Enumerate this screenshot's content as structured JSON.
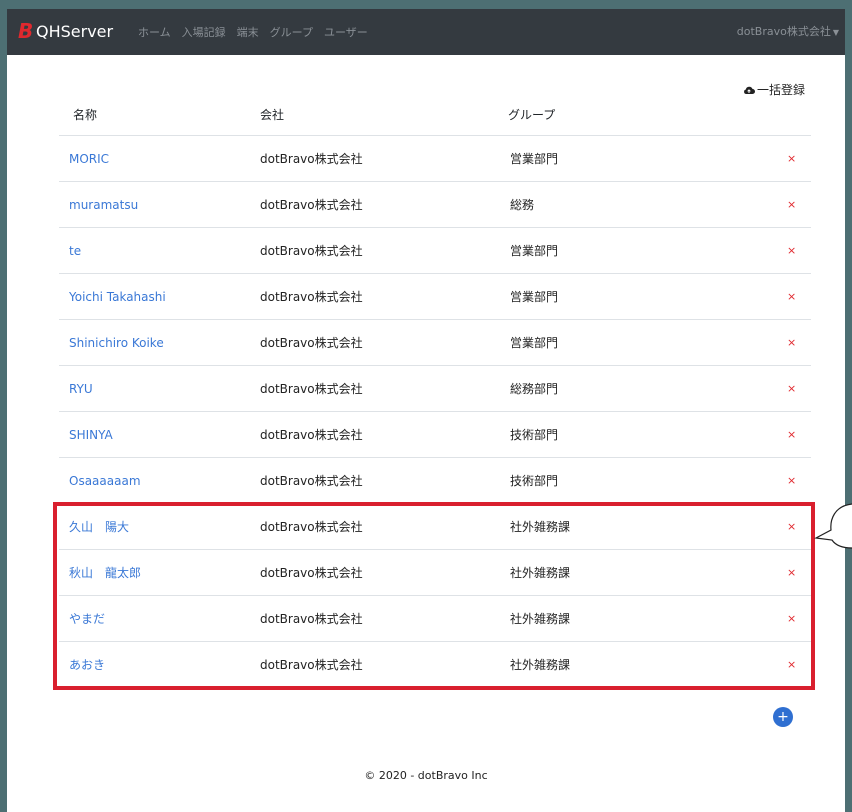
{
  "navbar": {
    "brand": "QHServer",
    "links": [
      "ホーム",
      "入場記録",
      "端末",
      "グループ",
      "ユーザー"
    ],
    "user_menu": "dotBravo株式会社"
  },
  "toolbar": {
    "bulk_register_label": "一括登録"
  },
  "table": {
    "headers": [
      "名称",
      "会社",
      "グループ"
    ],
    "delete_symbol": "×",
    "rows": [
      {
        "name": "MORIC",
        "company": "dotBravo株式会社",
        "group": "営業部門"
      },
      {
        "name": "muramatsu",
        "company": "dotBravo株式会社",
        "group": "総務"
      },
      {
        "name": "te",
        "company": "dotBravo株式会社",
        "group": "営業部門"
      },
      {
        "name": "Yoichi Takahashi",
        "company": "dotBravo株式会社",
        "group": "営業部門"
      },
      {
        "name": "Shinichiro Koike",
        "company": "dotBravo株式会社",
        "group": "営業部門"
      },
      {
        "name": "RYU",
        "company": "dotBravo株式会社",
        "group": "総務部門"
      },
      {
        "name": "SHINYA",
        "company": "dotBravo株式会社",
        "group": "技術部門"
      },
      {
        "name": "Osaaaaaam",
        "company": "dotBravo株式会社",
        "group": "技術部門"
      },
      {
        "name": "久山　陽大",
        "company": "dotBravo株式会社",
        "group": "社外雑務課"
      },
      {
        "name": "秋山　龍太郎",
        "company": "dotBravo株式会社",
        "group": "社外雑務課"
      },
      {
        "name": "やまだ",
        "company": "dotBravo株式会社",
        "group": "社外雑務課"
      },
      {
        "name": "あおき",
        "company": "dotBravo株式会社",
        "group": "社外雑務課"
      }
    ]
  },
  "add_button": {
    "symbol": "+"
  },
  "footer": {
    "text": "© 2020 - dotBravo Inc"
  },
  "colors": {
    "navbar": "#343a40",
    "link": "#3a78d6",
    "danger": "#e0282e",
    "highlight": "#d91f2e",
    "primary": "#2f6fd1"
  }
}
